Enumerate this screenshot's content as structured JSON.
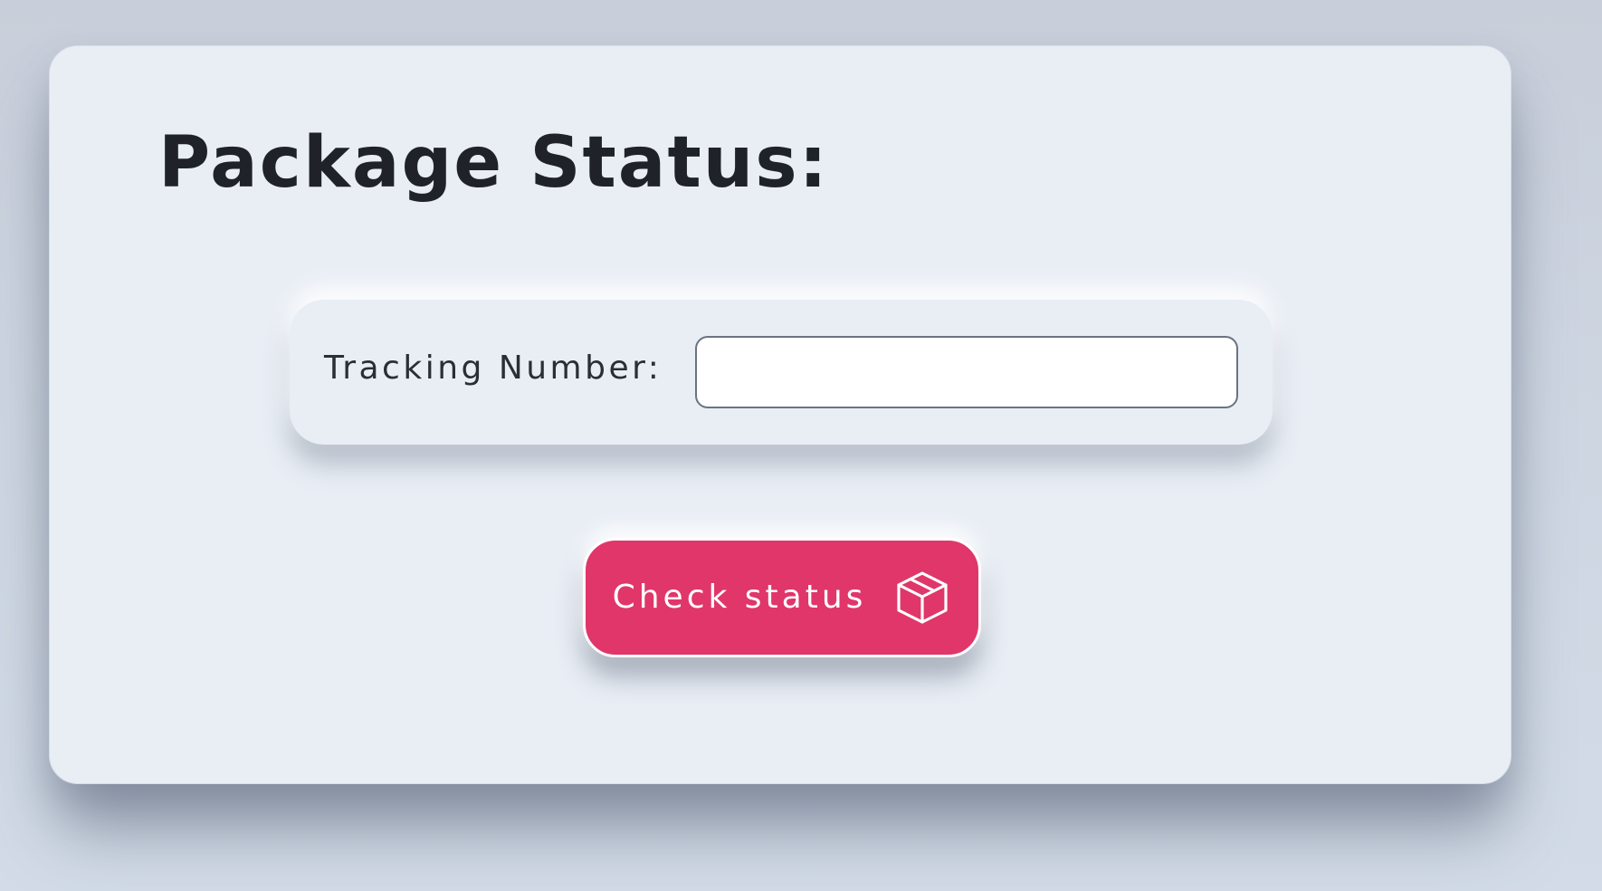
{
  "page": {
    "title": "Package Status:"
  },
  "form": {
    "tracking_label": "Tracking Number:",
    "tracking_value": "",
    "tracking_placeholder": ""
  },
  "actions": {
    "check_label": "Check status",
    "check_icon": "package-box-icon"
  },
  "colors": {
    "accent": "#e0366a",
    "card_background": "#e9eef5",
    "page_background": "#cdd5e1",
    "text": "#1f2329"
  }
}
